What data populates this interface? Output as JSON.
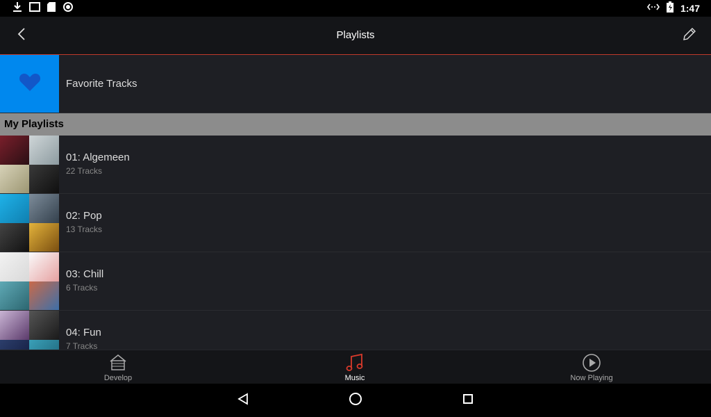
{
  "status_bar": {
    "time": "1:47"
  },
  "app_bar": {
    "title": "Playlists"
  },
  "favorites": {
    "label": "Favorite Tracks",
    "tile_color": "#0088ee"
  },
  "section": {
    "title": "My Playlists"
  },
  "playlists": [
    {
      "name": "01: Algemeen",
      "count": "22 Tracks"
    },
    {
      "name": "02: Pop",
      "count": "13 Tracks"
    },
    {
      "name": "03: Chill",
      "count": "6 Tracks"
    },
    {
      "name": "04: Fun",
      "count": "7 Tracks"
    }
  ],
  "bottom_nav": {
    "tabs": [
      {
        "label": "Develop",
        "icon": "house-icon"
      },
      {
        "label": "Music",
        "icon": "music-note-icon",
        "active": true
      },
      {
        "label": "Now Playing",
        "icon": "play-circle-icon"
      }
    ]
  },
  "colors": {
    "accent": "#c0392b",
    "favorite_tile": "#0088ee"
  }
}
